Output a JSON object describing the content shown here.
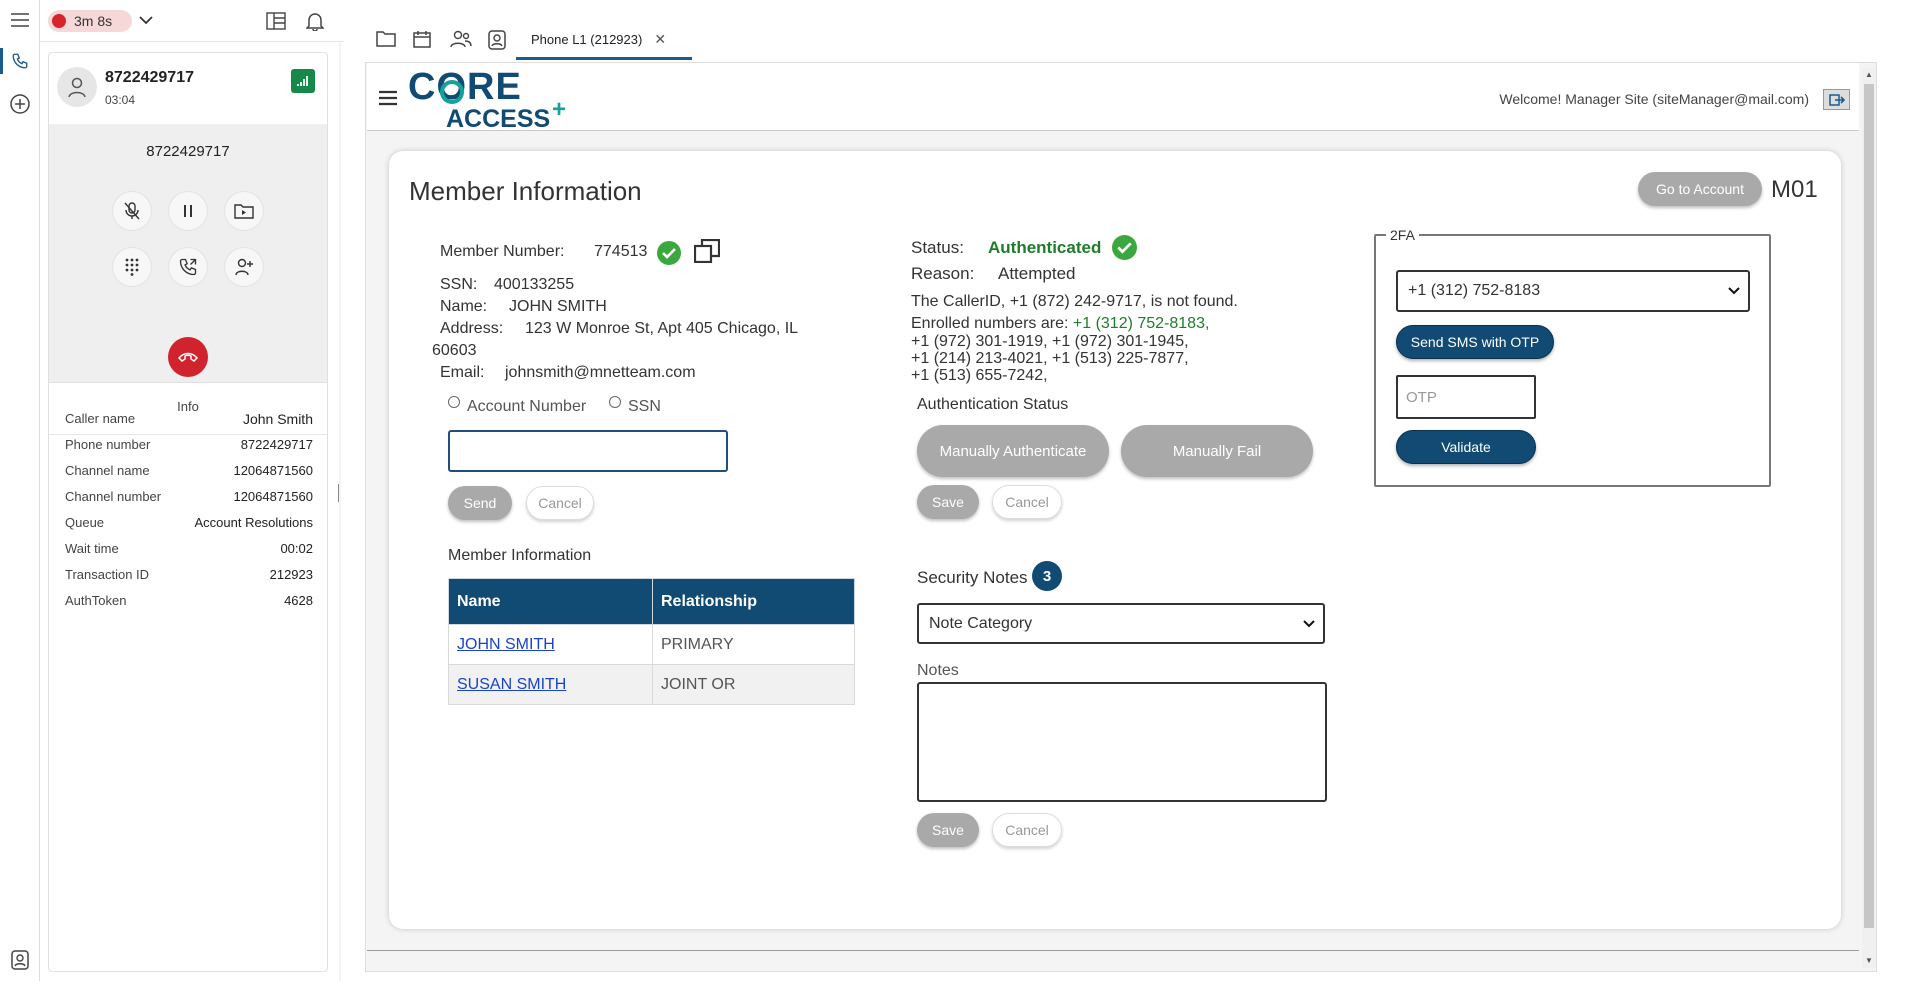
{
  "topbar": {
    "timer": "3m 8s"
  },
  "call": {
    "number": "8722429717",
    "duration": "03:04",
    "display_number": "8722429717",
    "info_tab": "Info",
    "details": [
      {
        "key": "Caller name",
        "value": "John Smith"
      },
      {
        "key": "Phone number",
        "value": "8722429717"
      },
      {
        "key": "Channel name",
        "value": "12064871560"
      },
      {
        "key": "Channel number",
        "value": "12064871560"
      },
      {
        "key": "Queue",
        "value": "Account Resolutions"
      },
      {
        "key": "Wait time",
        "value": "00:02"
      },
      {
        "key": "Transaction ID",
        "value": "212923"
      },
      {
        "key": "AuthToken",
        "value": "4628"
      }
    ]
  },
  "tabs": {
    "active_label": "Phone L1 (212923)"
  },
  "app": {
    "logo_line1": "CORE",
    "logo_line2": "ACCESS",
    "welcome": "Welcome! Manager Site (siteManager@mail.com)"
  },
  "card": {
    "title": "Member Information",
    "go_to_account": "Go to Account",
    "code": "M01"
  },
  "member": {
    "number_label": "Member Number:",
    "number": "774513",
    "ssn_label": "SSN:",
    "ssn": "400133255",
    "name_label": "Name:",
    "name": "JOHN SMITH",
    "address_label": "Address:",
    "address_line1": "123 W Monroe St, Apt 405 Chicago, IL",
    "address_line2": "60603",
    "email_label": "Email:",
    "email": "johnsmith@mnetteam.com",
    "radio_account": "Account Number",
    "radio_ssn": "SSN",
    "send": "Send",
    "cancel": "Cancel",
    "table_title": "Member Information",
    "table_headers": [
      "Name",
      "Relationship"
    ],
    "table_rows": [
      {
        "name": "JOHN SMITH",
        "relationship": "PRIMARY"
      },
      {
        "name": "SUSAN SMITH",
        "relationship": "JOINT OR"
      }
    ]
  },
  "auth": {
    "status_label": "Status:",
    "status_value": "Authenticated",
    "reason_label": "Reason:",
    "reason_value": "Attempted",
    "callerid_line": "The CallerID, +1 (872) 242-9717, is not found.",
    "enrolled_prefix": "Enrolled numbers are:",
    "enrolled_highlight": "+1 (312) 752-8183,",
    "enrolled_line2": "+1 (972) 301-1919, +1 (972) 301-1945,",
    "enrolled_line3": "+1 (214) 213-4021, +1 (513) 225-7877,",
    "enrolled_line4": "+1 (513) 655-7242,",
    "section_title": "Authentication Status",
    "manually_authenticate": "Manually Authenticate",
    "manually_fail": "Manually Fail",
    "save": "Save",
    "cancel": "Cancel"
  },
  "security": {
    "title": "Security Notes",
    "count": "3",
    "category_selected": "Note Category",
    "notes_label": "Notes",
    "save": "Save",
    "cancel": "Cancel"
  },
  "twofa": {
    "legend": "2FA",
    "phone_selected": "+1 (312) 752-8183",
    "send_sms": "Send SMS with OTP",
    "otp_placeholder": "OTP",
    "validate": "Validate"
  },
  "colors": {
    "navy": "#114a73",
    "green": "#1d7d2b",
    "hangup_red": "#d0232e",
    "timer_red": "#d8232a"
  }
}
